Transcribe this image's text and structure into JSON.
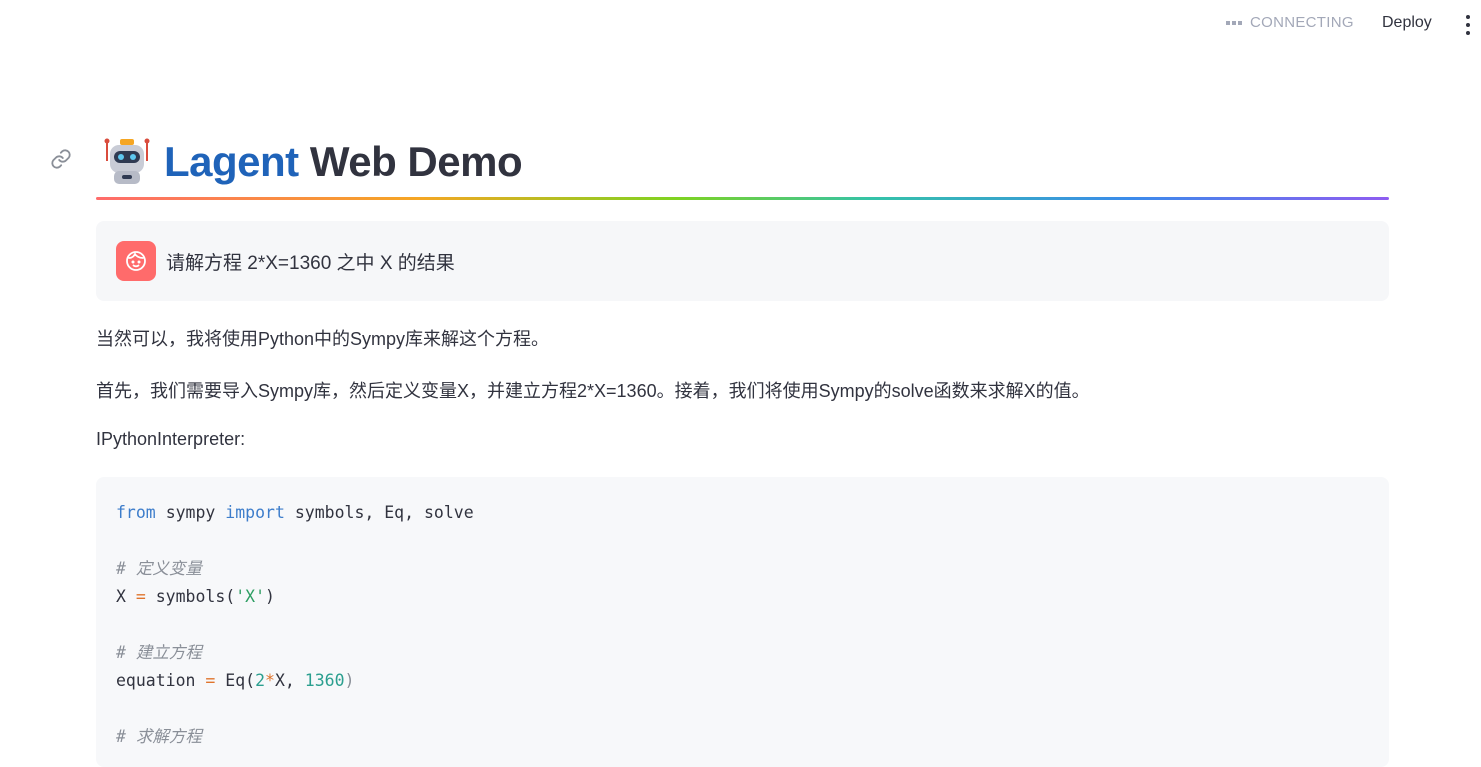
{
  "header": {
    "status_text": "CONNECTING",
    "deploy_label": "Deploy"
  },
  "page": {
    "title_brand": "Lagent",
    "title_rest": "Web Demo"
  },
  "chat": {
    "user_message": "请解方程 2*X=1360 之中 X 的结果",
    "assistant": {
      "para1": "当然可以，我将使用Python中的Sympy库来解这个方程。",
      "para2": "首先，我们需要导入Sympy库，然后定义变量X，并建立方程2*X=1360。接着，我们将使用Sympy的solve函数来求解X的值。",
      "tool_label": "IPythonInterpreter:"
    },
    "code": {
      "line1": {
        "kw_from": "from",
        "module": "sympy",
        "kw_import": "import",
        "names": "symbols, Eq, solve"
      },
      "comment1": "# 定义变量",
      "line2": {
        "lhs": "X",
        "op": "=",
        "fn": "symbols(",
        "arg": "'X'",
        "close": ")"
      },
      "comment2": "# 建立方程",
      "line3": {
        "lhs": "equation",
        "op": "=",
        "fn": "Eq(",
        "a": "2",
        "mul": "*",
        "b": "X, ",
        "c": "1360",
        "close": ")"
      },
      "comment3": "# 求解方程"
    }
  },
  "icons": {
    "status": "dots-icon",
    "menu": "kebab-menu-icon",
    "anchor": "link-icon",
    "title": "robot-icon",
    "user": "user-face-icon"
  },
  "colors": {
    "brand": "#1f63b9",
    "user_avatar": "#ff6b6b",
    "code_bg": "#f7f8fa"
  }
}
